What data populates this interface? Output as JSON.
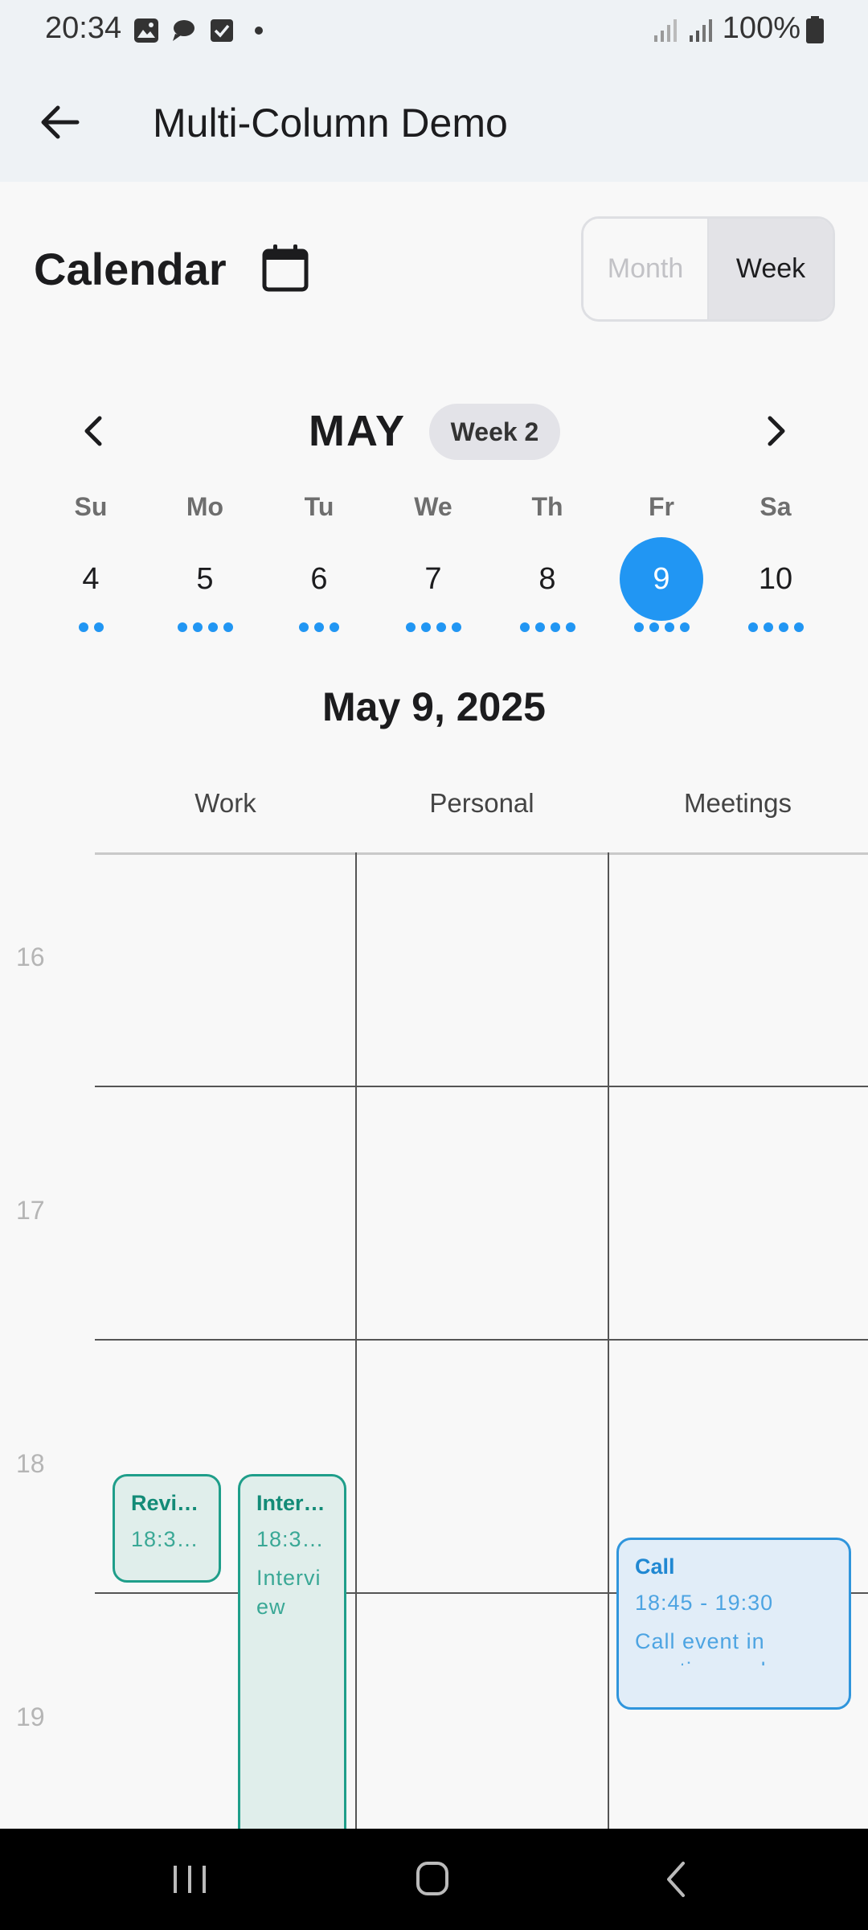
{
  "status_bar": {
    "time": "20:34",
    "battery": "100%"
  },
  "app_bar": {
    "title": "Multi-Column Demo"
  },
  "header": {
    "title": "Calendar",
    "view_toggle": {
      "month": "Month",
      "week": "Week",
      "selected": "Week"
    }
  },
  "week_nav": {
    "month": "MAY",
    "week_label": "Week 2"
  },
  "days": [
    {
      "dow": "Su",
      "num": "4",
      "dots": 2
    },
    {
      "dow": "Mo",
      "num": "5",
      "dots": 4
    },
    {
      "dow": "Tu",
      "num": "6",
      "dots": 3
    },
    {
      "dow": "We",
      "num": "7",
      "dots": 4
    },
    {
      "dow": "Th",
      "num": "8",
      "dots": 4
    },
    {
      "dow": "Fr",
      "num": "9",
      "dots": 4,
      "selected": true
    },
    {
      "dow": "Sa",
      "num": "10",
      "dots": 4
    }
  ],
  "selected_date": "May 9, 2025",
  "columns": [
    "Work",
    "Personal",
    "Meetings"
  ],
  "hours": [
    "16",
    "17",
    "18",
    "19"
  ],
  "events": [
    {
      "title": "Revi…",
      "time": "18:3…"
    },
    {
      "title": "Inter…",
      "time": "18:3…",
      "desc": "Intervi ew e…"
    },
    {
      "title": "Call",
      "time": "18:45 - 19:30",
      "desc": "Call event in meetings colum"
    }
  ],
  "colors": {
    "accent": "#2196f3",
    "work": "#1f9e8a",
    "meetings": "#2f95dc"
  }
}
